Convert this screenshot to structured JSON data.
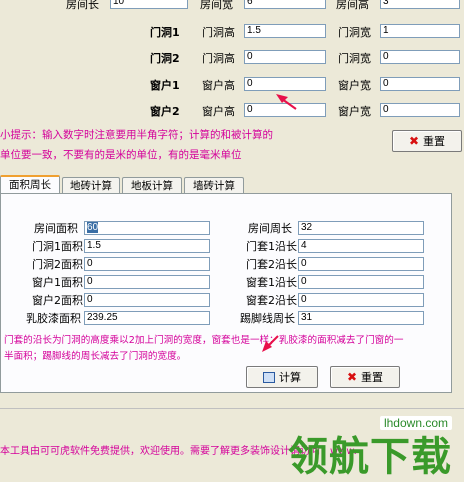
{
  "top_row": {
    "room_length_label": "房间长",
    "room_length_value": "10",
    "room_width_label": "房间宽",
    "room_width_value": "6",
    "room_height_label": "房间高",
    "room_height_value": "3"
  },
  "openings": [
    {
      "name": "门洞1",
      "height_label": "门洞高",
      "height_value": "1.5",
      "width_label": "门洞宽",
      "width_value": "1"
    },
    {
      "name": "门洞2",
      "height_label": "门洞高",
      "height_value": "0",
      "width_label": "门洞宽",
      "width_value": "0"
    },
    {
      "name": "窗户1",
      "height_label": "窗户高",
      "height_value": "0",
      "width_label": "窗户宽",
      "width_value": "0"
    },
    {
      "name": "窗户2",
      "height_label": "窗户高",
      "height_value": "0",
      "width_label": "窗户宽",
      "width_value": "0"
    }
  ],
  "tips": {
    "line1": "小提示：输入数字时注意要用半角字符；计算的和被计算的",
    "line2": "单位要一致，不要有的是米的单位，有的是毫米单位"
  },
  "reset_label_top": "重置",
  "tabs": [
    "面积周长",
    "地砖计算",
    "地板计算",
    "墙砖计算"
  ],
  "results": {
    "left": [
      {
        "label": "房间面积",
        "value": "60",
        "selected": true
      },
      {
        "label": "门洞1面积",
        "value": "1.5"
      },
      {
        "label": "门洞2面积",
        "value": "0"
      },
      {
        "label": "窗户1面积",
        "value": "0"
      },
      {
        "label": "窗户2面积",
        "value": "0"
      },
      {
        "label": "乳胶漆面积",
        "value": "239.25"
      }
    ],
    "right": [
      {
        "label": "房间周长",
        "value": "32"
      },
      {
        "label": "门套1沿长",
        "value": "4"
      },
      {
        "label": "门套2沿长",
        "value": "0"
      },
      {
        "label": "窗套1沿长",
        "value": "0"
      },
      {
        "label": "窗套2沿长",
        "value": "0"
      },
      {
        "label": "踢脚线周长",
        "value": "31"
      }
    ]
  },
  "note": {
    "line1": "门套的沿长为门洞的高度乘以2加上门洞的宽度，窗套也是一样；乳胶漆的面积减去了门窗的一",
    "line2": "半面积；踢脚线的周长减去了门洞的宽度。"
  },
  "calc_label": "计算",
  "reset_label_bottom": "重置",
  "footer": "本工具由可可虎软件免费提供，欢迎使用。需要了解更多装饰设计请访问：www.",
  "watermark": {
    "text": "领航下载",
    "site": "lhdown.com"
  },
  "colors": {
    "tip": "#d4009a",
    "watermark": "#3a9a2a",
    "arrow": "#e8104a"
  }
}
